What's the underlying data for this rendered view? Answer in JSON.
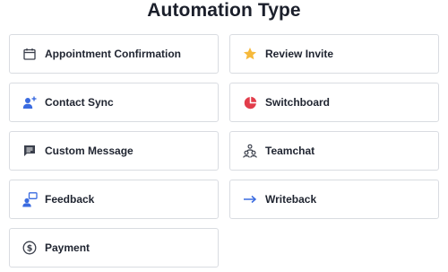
{
  "heading": "Automation Type",
  "colors": {
    "blue": "#3a6be0",
    "star": "#f6b93b",
    "red": "#e23d4b",
    "dark": "#3a3f4b"
  },
  "cards": [
    {
      "label": "Appointment Confirmation",
      "icon": "calendar-icon"
    },
    {
      "label": "Review Invite",
      "icon": "star-icon"
    },
    {
      "label": "Contact Sync",
      "icon": "add-contact-icon"
    },
    {
      "label": "Switchboard",
      "icon": "pie-chart-icon"
    },
    {
      "label": "Custom Message",
      "icon": "message-icon"
    },
    {
      "label": "Teamchat",
      "icon": "team-icon"
    },
    {
      "label": "Feedback",
      "icon": "feedback-icon"
    },
    {
      "label": "Writeback",
      "icon": "arrow-right-icon"
    },
    {
      "label": "Payment",
      "icon": "dollar-icon"
    }
  ]
}
